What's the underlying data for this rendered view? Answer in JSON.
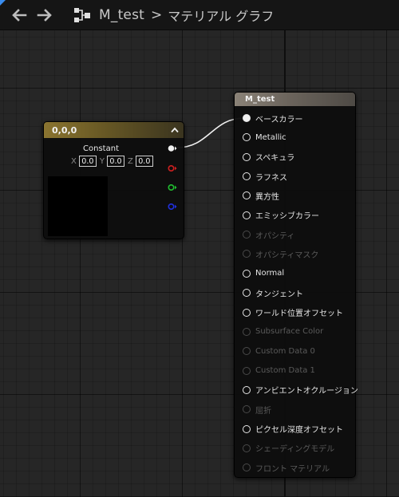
{
  "breadcrumb": {
    "asset": "M_test",
    "separator": ">",
    "graph": "マテリアル グラフ"
  },
  "icons": {
    "back": "arrow-left-icon",
    "forward": "arrow-right-icon",
    "graph": "graph-icon",
    "collapse": "chevron-up-icon"
  },
  "constant_node": {
    "title": "0,0,0",
    "label": "Constant",
    "fields": [
      {
        "axis": "X",
        "value": "0.0"
      },
      {
        "axis": "Y",
        "value": "0.0"
      },
      {
        "axis": "Z",
        "value": "0.0"
      }
    ],
    "output_colors": [
      "#f2f2f2",
      "#d02020",
      "#20c030",
      "#2030e0"
    ]
  },
  "material_node": {
    "title": "M_test",
    "pins": [
      {
        "label": "ベースカラー",
        "state": "connected"
      },
      {
        "label": "Metallic",
        "state": "active"
      },
      {
        "label": "スペキュラ",
        "state": "active"
      },
      {
        "label": "ラフネス",
        "state": "active"
      },
      {
        "label": "異方性",
        "state": "active"
      },
      {
        "label": "エミッシブカラー",
        "state": "active"
      },
      {
        "label": "オパシティ",
        "state": "disabled"
      },
      {
        "label": "オパシティマスク",
        "state": "disabled"
      },
      {
        "label": "Normal",
        "state": "active"
      },
      {
        "label": "タンジェント",
        "state": "active"
      },
      {
        "label": "ワールド位置オフセット",
        "state": "active"
      },
      {
        "label": "Subsurface Color",
        "state": "disabled"
      },
      {
        "label": "Custom Data 0",
        "state": "disabled"
      },
      {
        "label": "Custom Data 1",
        "state": "disabled"
      },
      {
        "label": "アンビエントオクルージョン",
        "state": "active"
      },
      {
        "label": "屈折",
        "state": "disabled"
      },
      {
        "label": "ピクセル深度オフセット",
        "state": "active"
      },
      {
        "label": "シェーディングモデル",
        "state": "disabled"
      },
      {
        "label": "フロント マテリアル",
        "state": "disabled"
      }
    ]
  }
}
